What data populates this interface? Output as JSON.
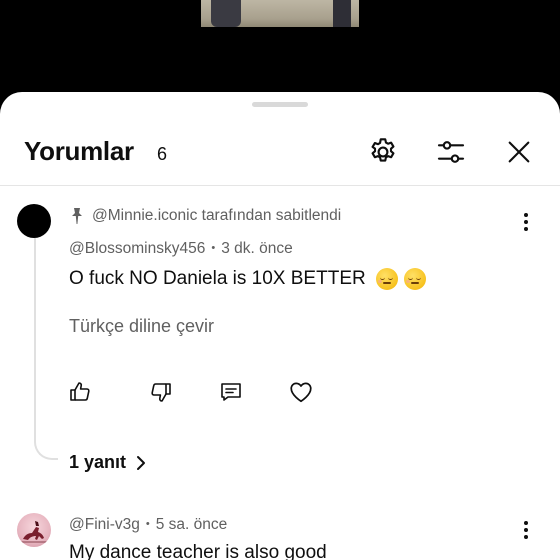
{
  "header": {
    "title": "Yorumlar",
    "count": "6"
  },
  "icons": {
    "settings": "gear-icon",
    "filter": "sliders-icon",
    "close": "close-icon",
    "pin": "pin-icon",
    "like": "thumbs-up-icon",
    "dislike": "thumbs-down-icon",
    "reply": "reply-icon",
    "heart": "heart-icon",
    "more": "more-vert-icon",
    "chevron": "chevron-right-icon"
  },
  "comments": [
    {
      "pinned_text": "@Minnie.iconic tarafından sabitlendi",
      "author": "@Blossominsky456",
      "separator": "•",
      "time": "3 dk. önce",
      "text": "O fuck NO Daniela is 10X BETTER",
      "emojis": [
        "relieved-face-emoji",
        "relieved-face-emoji"
      ],
      "translate_label": "Türkçe diline çevir",
      "replies_label": "1 yanıt"
    },
    {
      "author": "@Fini-v3g",
      "separator": "•",
      "time": "5 sa. önce",
      "text": "My dance teacher is also good"
    }
  ],
  "colors": {
    "primary_text": "#0f0f0f",
    "secondary_text": "#606060",
    "divider": "#e5e5e5",
    "sheet_bg": "#ffffff",
    "backdrop": "#000000"
  }
}
